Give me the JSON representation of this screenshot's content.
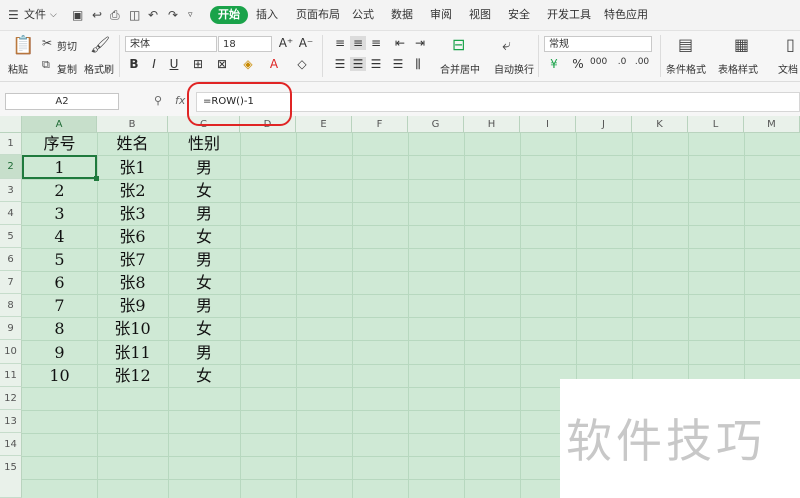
{
  "menubar": {
    "file_label": "文件",
    "tabs": [
      "开始",
      "插入",
      "页面布局",
      "公式",
      "数据",
      "审阅",
      "视图",
      "安全",
      "开发工具",
      "特色应用"
    ]
  },
  "ribbon": {
    "paste_label": "粘贴",
    "cut_label": "剪切",
    "copy_label": "复制",
    "format_painter_label": "格式刷",
    "font_name": "宋体",
    "font_size": "18",
    "merge_center_label": "合并居中",
    "wrap_text_label": "自动换行",
    "number_format": "常规",
    "conditional_format_label": "条件格式",
    "table_style_label": "表格样式",
    "doc_label": "文档"
  },
  "formula_bar": {
    "name_box": "A2",
    "fx": "fx",
    "formula": "=ROW()-1"
  },
  "sheet": {
    "columns": [
      "A",
      "B",
      "C",
      "D",
      "E",
      "F",
      "G",
      "H",
      "I",
      "J",
      "K",
      "L",
      "M"
    ],
    "row_numbers": [
      "1",
      "2",
      "3",
      "4",
      "5",
      "6",
      "7",
      "8",
      "9",
      "10",
      "11",
      "12",
      "13",
      "14",
      "15"
    ],
    "header": [
      "序号",
      "姓名",
      "性别"
    ],
    "rows": [
      [
        "1",
        "张1",
        "男"
      ],
      [
        "2",
        "张2",
        "女"
      ],
      [
        "3",
        "张3",
        "男"
      ],
      [
        "4",
        "张6",
        "女"
      ],
      [
        "5",
        "张7",
        "男"
      ],
      [
        "6",
        "张8",
        "女"
      ],
      [
        "7",
        "张9",
        "男"
      ],
      [
        "8",
        "张10",
        "女"
      ],
      [
        "9",
        "张11",
        "男"
      ],
      [
        "10",
        "张12",
        "女"
      ]
    ],
    "active_cell": "A2"
  },
  "watermark": "软件技巧",
  "colors": {
    "accent": "#1aa34a",
    "grid_background": "#cfe9d5",
    "highlight": "#e02424"
  }
}
